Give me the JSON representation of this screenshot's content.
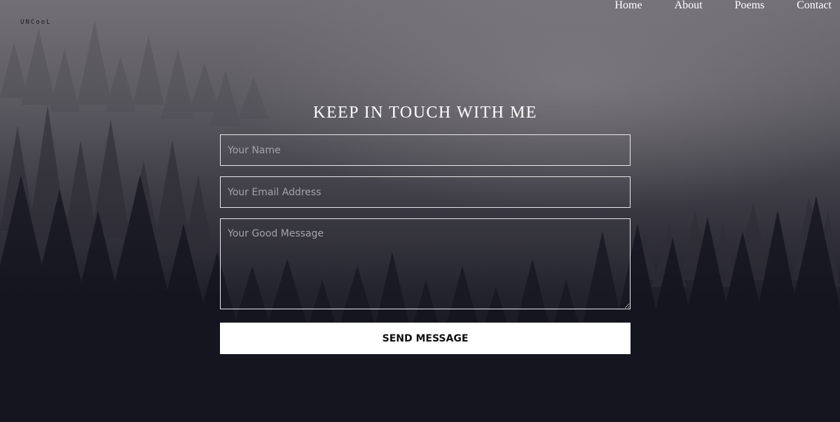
{
  "brand": {
    "logo_text": "UNCooL"
  },
  "nav": {
    "items": [
      {
        "label": "Home"
      },
      {
        "label": "About"
      },
      {
        "label": "Poems"
      },
      {
        "label": "Contact"
      }
    ]
  },
  "contact": {
    "title": "KEEP IN TOUCH WITH ME",
    "name_field": {
      "value": "",
      "placeholder": "Your Name"
    },
    "email_field": {
      "value": "",
      "placeholder": "Your Email Address"
    },
    "message_field": {
      "value": "",
      "placeholder": "Your Good Message"
    },
    "submit_label": "SEND MESSAGE"
  },
  "colors": {
    "text": "#ffffff",
    "button_bg": "#ffffff",
    "button_text": "#111111",
    "field_border": "#e8e8ea"
  }
}
